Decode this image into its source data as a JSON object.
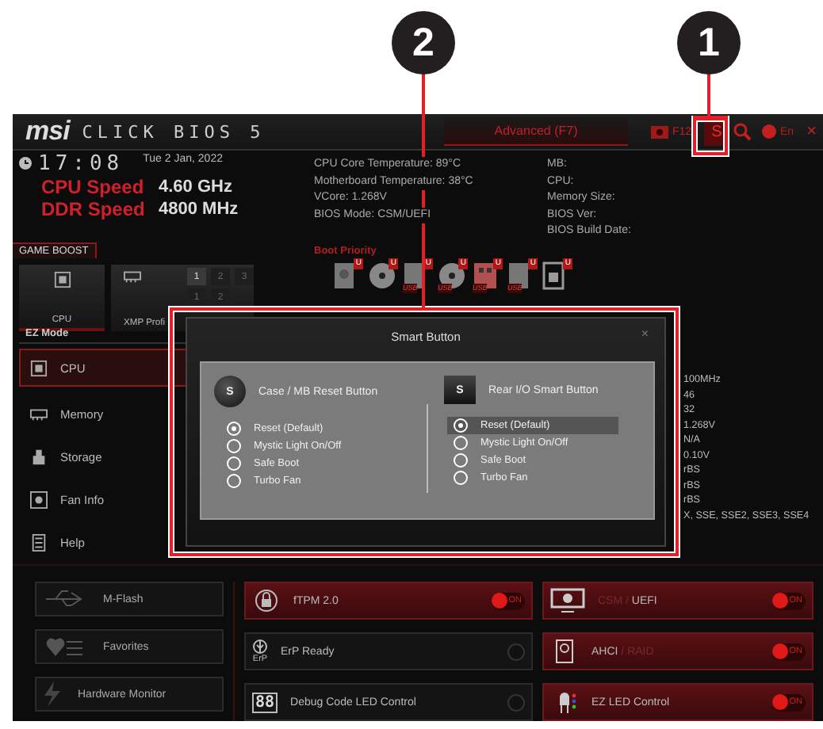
{
  "callouts": [
    {
      "label": "2"
    },
    {
      "label": "1"
    }
  ],
  "topbar": {
    "logo": "msi",
    "product": "CLICK BIOS 5",
    "mode_tab": "Advanced (F7)",
    "f12": "F12",
    "smart_button": "S",
    "language": "En",
    "close": "×"
  },
  "clock": {
    "time": "17:08",
    "date": "Tue  2 Jan, 2022"
  },
  "speeds": [
    {
      "label": "CPU Speed",
      "value": "4.60 GHz"
    },
    {
      "label": "DDR Speed",
      "value": "4800 MHz"
    }
  ],
  "system_info": [
    "CPU Core Temperature: 89°C",
    "Motherboard Temperature: 38°C",
    "VCore: 1.268V",
    "BIOS Mode: CSM/UEFI"
  ],
  "board_info": [
    "MB:",
    "CPU:",
    "Memory Size:",
    "BIOS Ver:",
    "BIOS Build Date:"
  ],
  "game_boost": {
    "label": "GAME BOOST",
    "cpu": "CPU",
    "xmp": "XMP Profi",
    "xmp_slots": [
      {
        "label": "1",
        "selected": true
      },
      {
        "label": "2",
        "selected": false
      },
      {
        "label": "3",
        "selected": false
      },
      {
        "label": "1",
        "selected": false
      },
      {
        "label": "2",
        "selected": false
      }
    ]
  },
  "boot_priority": {
    "title": "Boot Priority",
    "devices": [
      {
        "kind": "hdd",
        "badge": "U"
      },
      {
        "kind": "optical",
        "badge": "U"
      },
      {
        "kind": "usb",
        "badge": "U",
        "tag": "USB"
      },
      {
        "kind": "optical",
        "badge": "U",
        "tag": "USB"
      },
      {
        "kind": "stick",
        "badge": "U",
        "tag": "USB"
      },
      {
        "kind": "usb",
        "badge": "U",
        "tag": "USB"
      },
      {
        "kind": "network",
        "badge": "U"
      }
    ]
  },
  "ez_mode": {
    "label": "EZ Mode",
    "items": [
      {
        "kind": "cpu",
        "label": "CPU",
        "selected": true
      },
      {
        "kind": "memory",
        "label": "Memory",
        "selected": false
      },
      {
        "kind": "storage",
        "label": "Storage",
        "selected": false
      },
      {
        "kind": "fan",
        "label": "Fan Info",
        "selected": false
      },
      {
        "kind": "help",
        "label": "Help",
        "selected": false
      }
    ]
  },
  "detail_values": [
    "100MHz",
    "46",
    "32",
    "1.268V",
    "N/A",
    "0.10V",
    "rBS",
    "rBS",
    "rBS",
    "X, SSE, SSE2, SSE3, SSE4"
  ],
  "tools": [
    {
      "kind": "usb",
      "label": "M-Flash"
    },
    {
      "kind": "favorites",
      "label": "Favorites"
    },
    {
      "kind": "monitor",
      "label": "Hardware Monitor"
    }
  ],
  "toggles": [
    {
      "kind": "tpm",
      "parts": [
        {
          "text": "fTPM 2.0",
          "selected": true
        }
      ],
      "on": true,
      "switch_text": "ON"
    },
    {
      "kind": "erp",
      "icon_text": "ErP",
      "parts": [
        {
          "text": "ErP Ready",
          "selected": true
        }
      ],
      "on": false
    },
    {
      "kind": "debug",
      "icon_text": "88",
      "parts": [
        {
          "text": "Debug Code LED Control",
          "selected": true
        }
      ],
      "on": false
    },
    {
      "kind": "csm",
      "parts": [
        {
          "text": "CSM",
          "selected": false
        },
        {
          "text": " / ",
          "selected": false
        },
        {
          "text": "UEFI",
          "selected": true
        }
      ],
      "on": true,
      "switch_text": "ON"
    },
    {
      "kind": "ahci",
      "parts": [
        {
          "text": "AHCI",
          "selected": true
        },
        {
          "text": " / ",
          "selected": false
        },
        {
          "text": "RAID",
          "selected": false
        }
      ],
      "on": true,
      "switch_text": "ON"
    },
    {
      "kind": "led",
      "parts": [
        {
          "text": "EZ LED Control",
          "selected": true
        }
      ],
      "on": true,
      "switch_text": "ON"
    }
  ],
  "dialog": {
    "title": "Smart Button",
    "close": "×",
    "groups": [
      {
        "kind": "round",
        "badge": "S",
        "heading": "Case / MB Reset Button",
        "options": [
          {
            "label": "Reset (Default)",
            "selected": true
          },
          {
            "label": "Mystic Light On/Off",
            "selected": false
          },
          {
            "label": "Safe Boot",
            "selected": false
          },
          {
            "label": "Turbo Fan",
            "selected": false
          }
        ]
      },
      {
        "kind": "square",
        "badge": "S",
        "heading": "Rear I/O Smart Button",
        "options": [
          {
            "label": "Reset (Default)",
            "selected": true
          },
          {
            "label": "Mystic Light On/Off",
            "selected": false
          },
          {
            "label": "Safe Boot",
            "selected": false
          },
          {
            "label": "Turbo Fan",
            "selected": false
          }
        ]
      }
    ]
  }
}
